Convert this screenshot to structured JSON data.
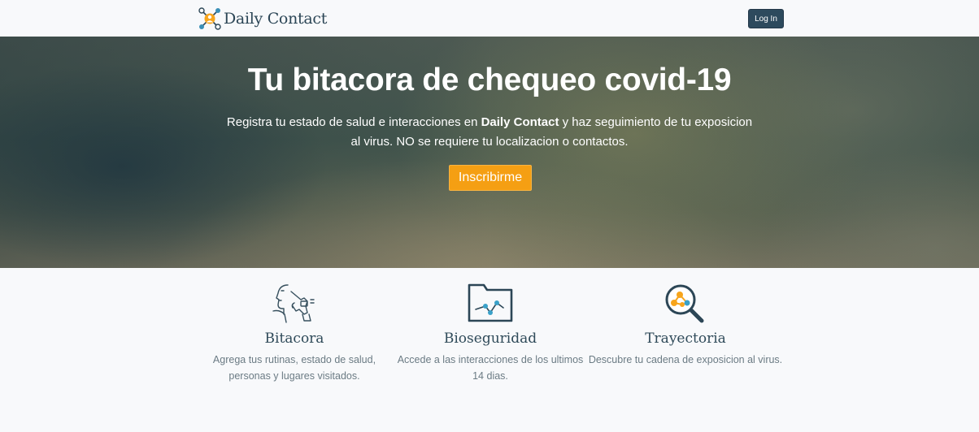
{
  "navbar": {
    "brand": "Daily Contact",
    "login_label": "Log In"
  },
  "hero": {
    "title": "Tu bitacora de chequeo covid-19",
    "subtitle_before": "Registra tu estado de salud e interacciones en ",
    "subtitle_brand": "Daily Contact",
    "subtitle_after": " y haz seguimiento de tu exposicion al virus. NO se requiere tu localizacion o contactos.",
    "cta_label": "Inscribirme"
  },
  "features": [
    {
      "icon": "face-thermometer-icon",
      "title": "Bitacora",
      "description": "Agrega tus rutinas, estado de salud, personas y lugares visitados."
    },
    {
      "icon": "folder-chart-icon",
      "title": "Bioseguridad",
      "description": "Accede a las interacciones de los ultimos 14 dias."
    },
    {
      "icon": "magnifier-network-icon",
      "title": "Trayectoria",
      "description": "Descubre tu cadena de exposicion al virus."
    }
  ],
  "colors": {
    "brand": "#2c4656",
    "accent": "#f59f13",
    "login_bg": "#2d4a5d",
    "logo_orange": "#f7a51c",
    "logo_teal": "#3a8fb7"
  }
}
